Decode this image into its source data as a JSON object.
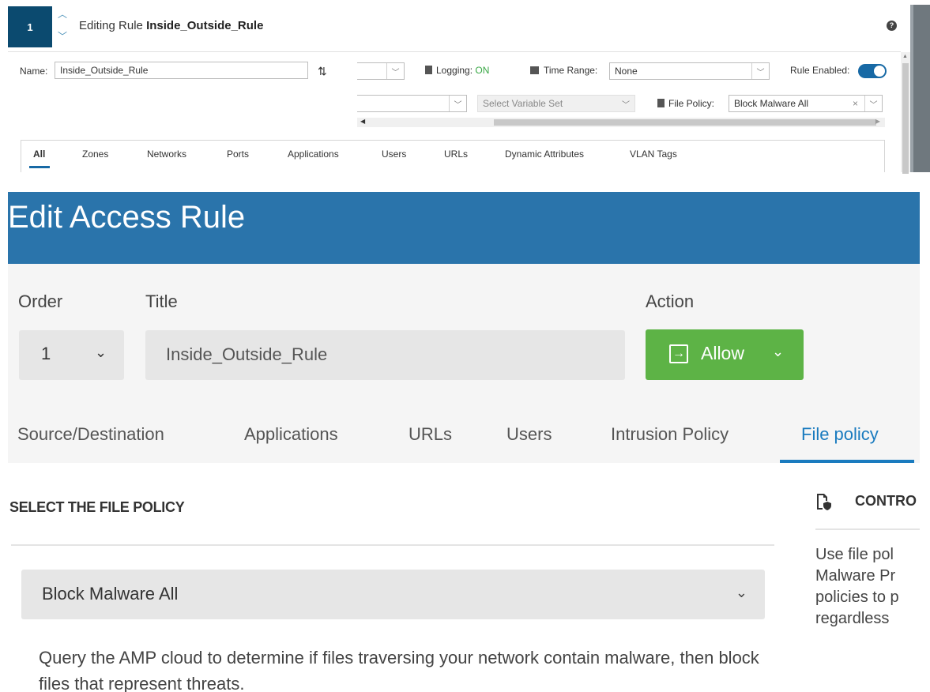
{
  "top": {
    "rule_number": "1",
    "editing_prefix": "Editing Rule",
    "rule_name": "Inside_Outside_Rule",
    "help_icon": "?",
    "name_label": "Name:",
    "name_value": "Inside_Outside_Rule",
    "logging_label": "Logging:",
    "logging_value": "ON",
    "time_range_label": "Time Range:",
    "time_range_value": "None",
    "rule_enabled_label": "Rule Enabled:",
    "rule_enabled": true,
    "variable_set_placeholder": "Select Variable Set",
    "file_policy_label": "File Policy:",
    "file_policy_value": "Block Malware All",
    "tabs": [
      "All",
      "Zones",
      "Networks",
      "Ports",
      "Applications",
      "Users",
      "URLs",
      "Dynamic Attributes",
      "VLAN Tags"
    ],
    "active_tab": "All"
  },
  "bottom": {
    "header_title": "Edit Access Rule",
    "order_label": "Order",
    "order_value": "1",
    "title_label": "Title",
    "title_value": "Inside_Outside_Rule",
    "action_label": "Action",
    "action_value": "Allow",
    "tabs": [
      "Source/Destination",
      "Applications",
      "URLs",
      "Users",
      "Intrusion Policy",
      "File policy"
    ],
    "active_tab": "File policy",
    "section_title": "SELECT THE FILE POLICY",
    "file_policy_value": "Block Malware All",
    "description": "Query the AMP cloud to determine if files traversing your network contain malware, then block files that represent threats.",
    "side_title": "CONTRO",
    "side_text": [
      "Use file pol",
      "Malware Pr",
      "policies to p",
      "regardless"
    ]
  },
  "colors": {
    "header_blue": "#2a74ab",
    "allow_green": "#5db346",
    "active_tab_blue": "#1a7bbf",
    "rule_number_bg": "#0b4a6f",
    "logging_on": "#39a845"
  }
}
